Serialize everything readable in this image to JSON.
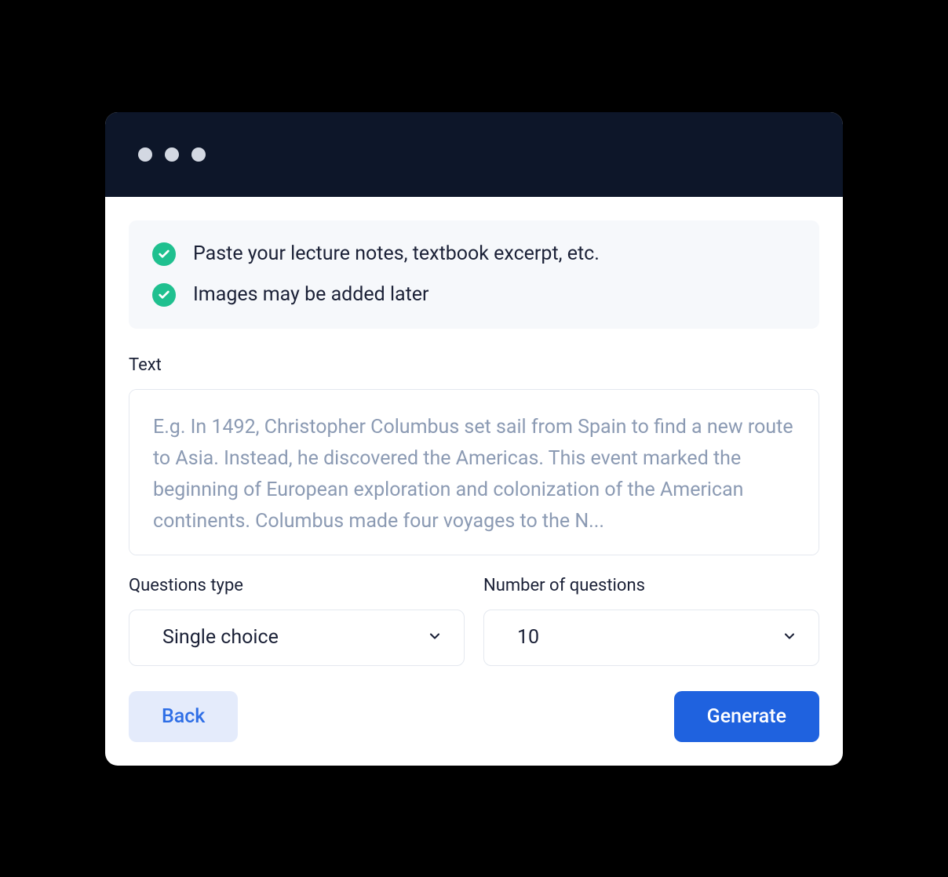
{
  "info": {
    "item1": "Paste your lecture notes, textbook excerpt, etc.",
    "item2": "Images may be added later"
  },
  "text_field": {
    "label": "Text",
    "placeholder": "E.g. In 1492, Christopher Columbus set sail from Spain to find a new route to Asia. Instead, he discovered the Americas. This event marked the beginning of European exploration and colonization of the American continents. Columbus made four voyages to the N..."
  },
  "question_type": {
    "label": "Questions type",
    "value": "Single choice"
  },
  "number_questions": {
    "label": "Number of questions",
    "value": "10"
  },
  "actions": {
    "back": "Back",
    "generate": "Generate"
  }
}
